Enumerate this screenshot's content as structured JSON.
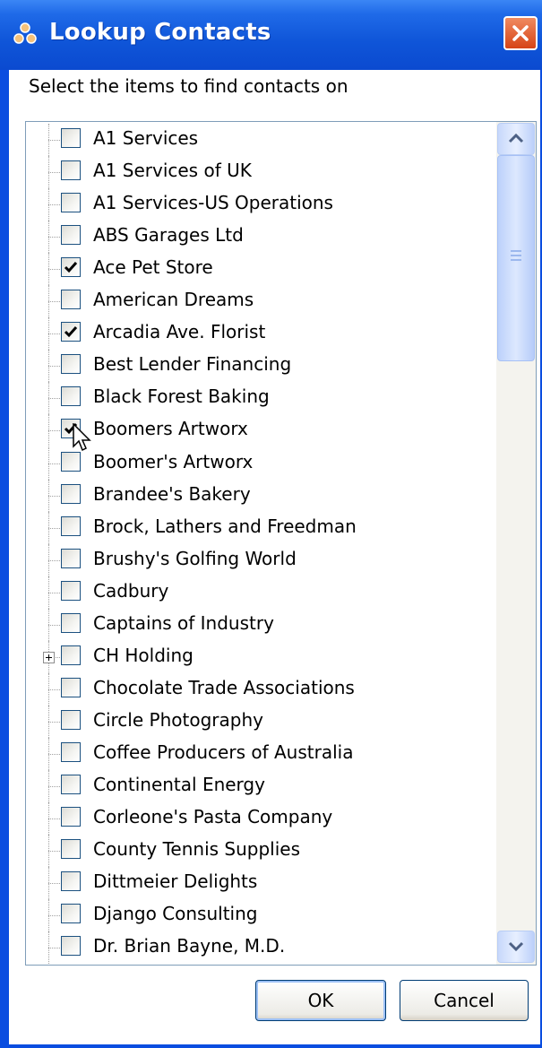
{
  "window": {
    "title": "Lookup Contacts",
    "title_icon": "contacts-group-icon",
    "close_icon": "close-icon"
  },
  "instruction": "Select the items to find contacts on",
  "contacts": [
    {
      "label": "A1 Services",
      "checked": false
    },
    {
      "label": "A1 Services of UK",
      "checked": false
    },
    {
      "label": "A1 Services-US Operations",
      "checked": false
    },
    {
      "label": "ABS Garages Ltd",
      "checked": false
    },
    {
      "label": "Ace Pet Store",
      "checked": true
    },
    {
      "label": "American Dreams",
      "checked": false
    },
    {
      "label": "Arcadia Ave. Florist",
      "checked": true
    },
    {
      "label": "Best Lender Financing",
      "checked": false
    },
    {
      "label": "Black Forest Baking",
      "checked": false
    },
    {
      "label": "Boomers Artworx",
      "checked": true
    },
    {
      "label": "Boomer's Artworx",
      "checked": false
    },
    {
      "label": "Brandee's Bakery",
      "checked": false
    },
    {
      "label": "Brock, Lathers and Freedman",
      "checked": false
    },
    {
      "label": "Brushy's Golfing World",
      "checked": false
    },
    {
      "label": "Cadbury",
      "checked": false
    },
    {
      "label": "Captains of Industry",
      "checked": false
    },
    {
      "label": "CH Holding",
      "checked": false,
      "expandable": true
    },
    {
      "label": "Chocolate Trade Associations",
      "checked": false
    },
    {
      "label": "Circle Photography",
      "checked": false
    },
    {
      "label": "Coffee Producers of Australia",
      "checked": false
    },
    {
      "label": "Continental Energy",
      "checked": false
    },
    {
      "label": "Corleone's Pasta Company",
      "checked": false
    },
    {
      "label": "County Tennis Supplies",
      "checked": false
    },
    {
      "label": "Dittmeier Delights",
      "checked": false
    },
    {
      "label": "Django Consulting",
      "checked": false
    },
    {
      "label": "Dr. Brian Bayne, M.D.",
      "checked": false
    }
  ],
  "buttons": {
    "ok": "OK",
    "cancel": "Cancel"
  },
  "colors": {
    "titlebar": "#0b4ad0",
    "close_button": "#d64416",
    "checkmark": "#000000"
  }
}
